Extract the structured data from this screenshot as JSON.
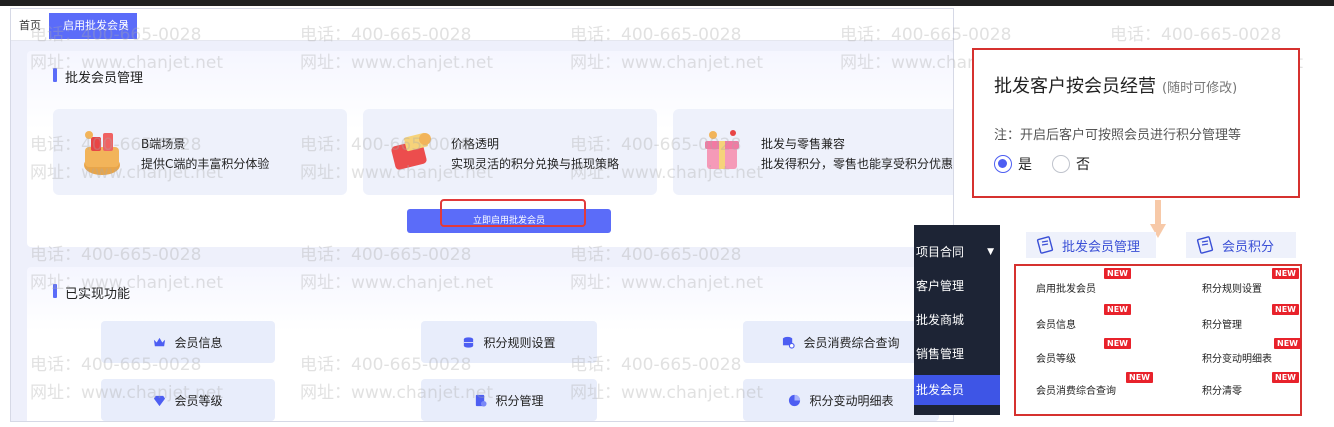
{
  "tabs": {
    "home": "首页",
    "active": "启用批发会员",
    "close": "×"
  },
  "section1": {
    "title": "批发会员管理",
    "features": [
      {
        "line1": "B端场景",
        "line2": "提供C端的丰富积分体验"
      },
      {
        "line1": "价格透明",
        "line2": "实现灵活的积分兑换与抵现策略"
      },
      {
        "line1": "批发与零售兼容",
        "line2": "批发得积分，零售也能享受积分优惠"
      }
    ],
    "enable_button": "立即启用批发会员"
  },
  "section2": {
    "title": "已实现功能",
    "buttons": [
      "会员信息",
      "积分规则设置",
      "会员消费综合查询",
      "会员等级",
      "积分管理",
      "积分变动明细表"
    ]
  },
  "watermark": {
    "phone": "电话：400-665-0028",
    "site": "网址：www.chanjet.net"
  },
  "setting_panel": {
    "title": "批发客户按会员经营",
    "hint": "(随时可修改)",
    "note": "注：开启后客户可按照会员进行积分管理等",
    "options": [
      "是",
      "否"
    ],
    "selected": "是"
  },
  "nav_menu": [
    "项目合同",
    "客户管理",
    "批发商城",
    "销售管理",
    "批发会员"
  ],
  "categories": [
    "批发会员管理",
    "会员积分"
  ],
  "menu_left": [
    "启用批发会员",
    "会员信息",
    "会员等级",
    "会员消费综合查询"
  ],
  "menu_right": [
    "积分规则设置",
    "积分管理",
    "积分变动明细表",
    "积分清零"
  ],
  "badge": "NEW",
  "colors": {
    "accent": "#5b6cf9",
    "highlight": "#d6312f",
    "nav_bg": "#1d2435"
  }
}
